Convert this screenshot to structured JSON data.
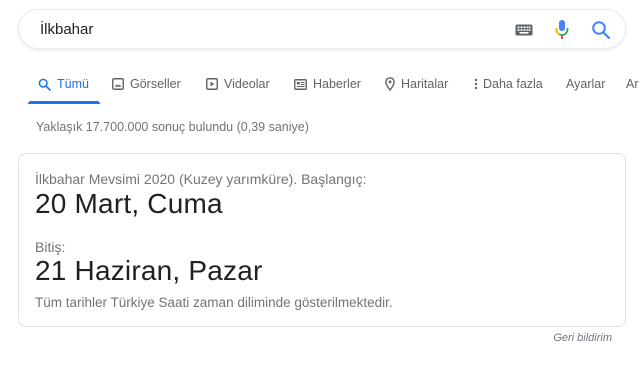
{
  "search": {
    "query": "İlkbahar"
  },
  "tabs": [
    {
      "label": "Tümü"
    },
    {
      "label": "Görseller"
    },
    {
      "label": "Videolar"
    },
    {
      "label": "Haberler"
    },
    {
      "label": "Haritalar"
    },
    {
      "label": "Daha fazla"
    },
    {
      "label": "Ayarlar"
    },
    {
      "label": "Ar"
    }
  ],
  "result_stats": "Yaklaşık 17.700.000 sonuç bulundu (0,39 saniye)",
  "card": {
    "heading": "İlkbahar Mevsimi 2020 (Kuzey yarımküre). Başlangıç:",
    "start_date": "20 Mart, Cuma",
    "end_label": "Bitiş:",
    "end_date": "21 Haziran, Pazar",
    "note": "Tüm tarihler Türkiye Saati zaman diliminde gösterilmektedir."
  },
  "feedback": "Geri bildirim",
  "colors": {
    "accent": "#1a73e8",
    "muted": "#70757a",
    "text": "#202124"
  },
  "icons": [
    "keyboard-icon",
    "microphone-icon",
    "search-icon",
    "images-icon",
    "video-icon",
    "news-icon",
    "map-pin-icon",
    "more-vert-icon"
  ]
}
